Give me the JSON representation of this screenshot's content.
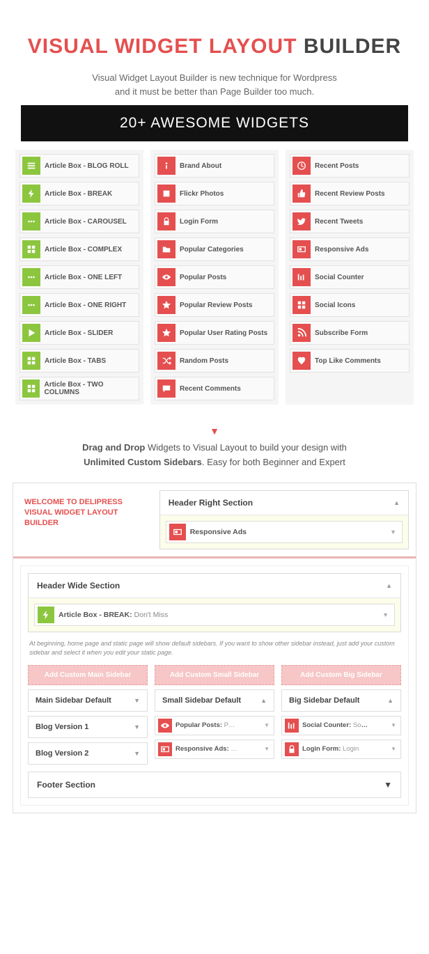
{
  "title": {
    "red": "VISUAL WIDGET LAYOUT",
    "black": "BUILDER"
  },
  "subtitle_l1": "Visual Widget Layout Builder is new technique for Wordpress",
  "subtitle_l2": "and it must be better than Page Builder too much.",
  "banner": "20+ AWESOME WIDGETS",
  "col1": [
    {
      "icon": "list",
      "label": "Article Box - BLOG ROLL"
    },
    {
      "icon": "bolt",
      "label": "Article Box - BREAK"
    },
    {
      "icon": "dots",
      "label": "Article Box - CAROUSEL"
    },
    {
      "icon": "grid",
      "label": "Article Box - COMPLEX"
    },
    {
      "icon": "dots",
      "label": "Article Box - ONE LEFT"
    },
    {
      "icon": "dots",
      "label": "Article Box - ONE RIGHT"
    },
    {
      "icon": "play",
      "label": "Article Box - SLIDER"
    },
    {
      "icon": "grid",
      "label": "Article Box - TABS"
    },
    {
      "icon": "grid",
      "label": "Article Box - TWO COLUMNS"
    }
  ],
  "col2": [
    {
      "icon": "info",
      "label": "Brand About"
    },
    {
      "icon": "square",
      "label": "Flickr Photos"
    },
    {
      "icon": "lock",
      "label": "Login Form"
    },
    {
      "icon": "folder",
      "label": "Popular Categories"
    },
    {
      "icon": "eye",
      "label": "Popular Posts"
    },
    {
      "icon": "star",
      "label": "Popular Review Posts"
    },
    {
      "icon": "star",
      "label": "Popular User Rating Posts"
    },
    {
      "icon": "random",
      "label": "Random Posts"
    },
    {
      "icon": "comment",
      "label": "Recent Comments"
    }
  ],
  "col3": [
    {
      "icon": "clock",
      "label": "Recent Posts"
    },
    {
      "icon": "thumb",
      "label": "Recent Review Posts"
    },
    {
      "icon": "twitter",
      "label": "Recent Tweets"
    },
    {
      "icon": "ads",
      "label": "Responsive Ads"
    },
    {
      "icon": "counter",
      "label": "Social Counter"
    },
    {
      "icon": "grid",
      "label": "Social Icons"
    },
    {
      "icon": "rss",
      "label": "Subscribe Form"
    },
    {
      "icon": "heart",
      "label": "Top Like Comments"
    }
  ],
  "desc": {
    "p1a": "Drag and Drop",
    "p1b": " Widgets to Visual Layout to build your design with",
    "p2a": "Unlimited Custom Sidebars",
    "p2b": ". Easy for both Beginner and Expert"
  },
  "builder": {
    "welcome": "WELCOME TO DELIPRESS VISUAL WIDGET LAYOUT BUILDER",
    "header_right": {
      "title": "Header Right Section",
      "item": {
        "icon": "ads",
        "label": "Responsive Ads"
      }
    },
    "header_wide": {
      "title": "Header Wide Section",
      "item": {
        "icon": "bolt",
        "label": "Article Box - BREAK:",
        "sub": " Don't Miss"
      }
    },
    "note": "At beginning, home page and static page will show default sidebars. If you want to show other sidebar instead, just add your custom sidebar and select it when you edit your static page.",
    "btns": [
      "Add Custom Main Sidebar",
      "Add Custom Small Sidebar",
      "Add Custom Big Sidebar"
    ],
    "main": {
      "default": "Main Sidebar Default",
      "v1": "Blog Version 1",
      "v2": "Blog Version 2"
    },
    "small": {
      "default": "Small Sidebar Default",
      "items": [
        {
          "icon": "eye",
          "label": "Popular Posts:",
          "sub": " P…"
        },
        {
          "icon": "ads",
          "label": "Responsive Ads:",
          "sub": " …"
        }
      ]
    },
    "big": {
      "default": "Big Sidebar Default",
      "items": [
        {
          "icon": "counter",
          "label": "Social Counter:",
          "sub": " Social …"
        },
        {
          "icon": "lock",
          "label": "Login Form:",
          "sub": " Login"
        }
      ]
    },
    "footer": "Footer Section"
  }
}
